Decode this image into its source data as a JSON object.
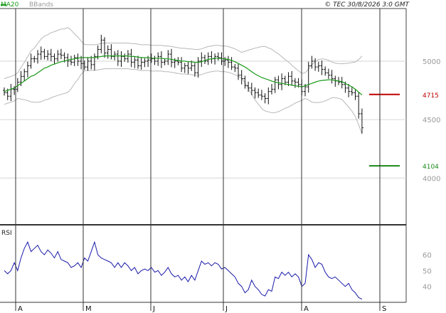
{
  "header": {
    "legend": [
      {
        "label": "MA20",
        "color": "#1a9a1a"
      },
      {
        "label": "BBands",
        "color": "#b0b0b0"
      }
    ],
    "copyright": "© TEC 30/8/2026 3:0 GMT"
  },
  "chart_data": [
    {
      "type": "ohlc",
      "y_ticks": [
        5000,
        4500,
        4000
      ],
      "y_tick_labels": [
        "5000",
        "4500",
        "4000"
      ],
      "ylim": [
        3600,
        5450
      ],
      "x_months": [
        "A",
        "M",
        "J",
        "J",
        "A",
        "S"
      ],
      "levels": [
        {
          "label": "4715",
          "value": 4715,
          "color": "#c00000"
        },
        {
          "label": "4104",
          "value": 4104,
          "color": "#1a8a1a"
        }
      ],
      "close": [
        4730,
        4700,
        4760,
        4760,
        4820,
        4870,
        4910,
        4960,
        5020,
        5020,
        5060,
        5080,
        5040,
        5060,
        5040,
        5020,
        5060,
        5050,
        5030,
        5000,
        4990,
        5030,
        5000,
        4980,
        4950,
        5000,
        4970,
        5040,
        5100,
        5180,
        5070,
        5100,
        5040,
        5060,
        5000,
        5040,
        5020,
        5060,
        4990,
        5010,
        4960,
        4990,
        5000,
        5010,
        5020,
        5000,
        5040,
        4990,
        5000,
        5060,
        4990,
        5000,
        4990,
        4940,
        4960,
        4940,
        4960,
        4900,
        5000,
        5030,
        5000,
        5040,
        5020,
        5040,
        5030,
        5000,
        5010,
        4990,
        4950,
        4940,
        4880,
        4850,
        4790,
        4770,
        4750,
        4730,
        4710,
        4700,
        4680,
        4740,
        4760,
        4840,
        4800,
        4850,
        4820,
        4870,
        4830,
        4820,
        4800,
        4740,
        4780,
        4960,
        5000,
        4950,
        4960,
        4930,
        4900,
        4880,
        4850,
        4830,
        4820,
        4800,
        4770,
        4740,
        4730,
        4700,
        4550,
        4430
      ],
      "ma20": [
        4740,
        4750,
        4760,
        4770,
        4790,
        4810,
        4830,
        4850,
        4870,
        4880,
        4900,
        4920,
        4940,
        4950,
        4965,
        4975,
        4985,
        4995,
        5000,
        5010,
        5015,
        5020,
        5025,
        5030,
        5030,
        5030,
        5030,
        5030,
        5035,
        5040,
        5045,
        5045,
        5045,
        5045,
        5045,
        5045,
        5045,
        5045,
        5040,
        5040,
        5035,
        5030,
        5030,
        5030,
        5025,
        5025,
        5025,
        5025,
        5020,
        5020,
        5015,
        5010,
        5005,
        5000,
        5000,
        4995,
        4995,
        4990,
        4990,
        4995,
        5005,
        5015,
        5020,
        5025,
        5025,
        5020,
        5020,
        5015,
        5005,
        4995,
        4980,
        4965,
        4950,
        4930,
        4910,
        4890,
        4875,
        4860,
        4850,
        4840,
        4830,
        4820,
        4815,
        4810,
        4805,
        4800,
        4795,
        4790,
        4785,
        4780,
        4790,
        4800,
        4810,
        4820,
        4830,
        4835,
        4838,
        4840,
        4840,
        4835,
        4830,
        4825,
        4810,
        4795,
        4780,
        4760,
        4735,
        4710
      ],
      "rsi_ticks": [
        60,
        50,
        40
      ],
      "rsi_tick_labels": [
        "60",
        "50",
        "40"
      ],
      "rsi_ylim": [
        30,
        78
      ],
      "rsi_title": "RSI",
      "rsi": [
        50,
        48,
        50,
        55,
        50,
        58,
        64,
        68,
        62,
        64,
        66,
        62,
        60,
        63,
        61,
        58,
        62,
        57,
        56,
        55,
        52,
        53,
        55,
        52,
        58,
        56,
        62,
        68,
        60,
        58,
        57,
        56,
        55,
        52,
        55,
        52,
        55,
        53,
        50,
        52,
        48,
        50,
        51,
        50,
        52,
        49,
        50,
        47,
        49,
        52,
        48,
        46,
        47,
        44,
        46,
        43,
        47,
        44,
        50,
        56,
        54,
        55,
        53,
        55,
        54,
        51,
        52,
        50,
        48,
        46,
        42,
        40,
        36,
        38,
        44,
        40,
        38,
        35,
        34,
        38,
        37,
        46,
        45,
        49,
        47,
        49,
        46,
        48,
        46,
        40,
        42,
        60,
        57,
        52,
        55,
        54,
        49,
        46,
        45,
        46,
        44,
        42,
        40,
        42,
        38,
        36,
        33,
        32
      ]
    }
  ]
}
